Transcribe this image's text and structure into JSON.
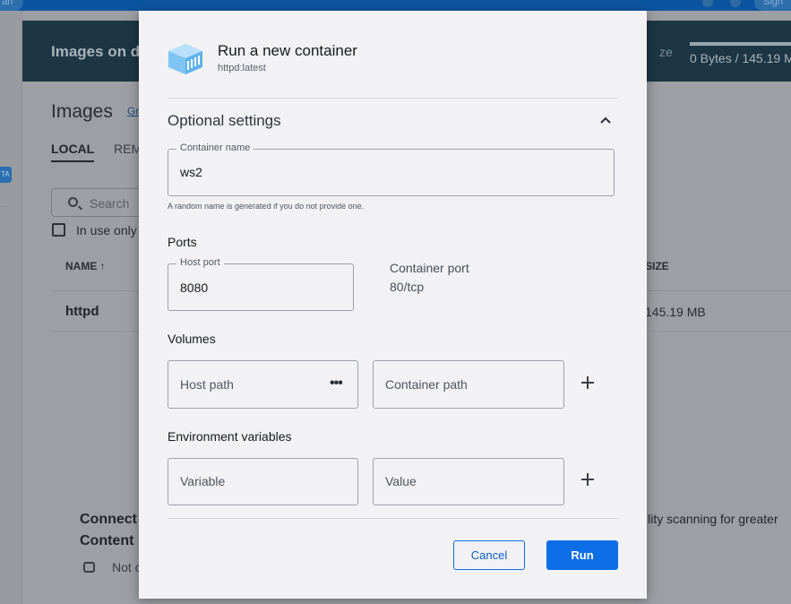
{
  "topbar": {
    "left_pill": "an",
    "right_pill": "Sign"
  },
  "sidebar": {
    "beta_badge": "TA"
  },
  "banner": {
    "title": "Images on di",
    "size_label": "ze",
    "size_value": "0 Bytes / 145.19 M",
    "usage_fraction": 1.0
  },
  "images_page": {
    "title": "Images",
    "title_link": "Gr",
    "tabs": [
      "LOCAL",
      "REM"
    ],
    "search_placeholder": "Search",
    "in_use_only_label": "In use only",
    "columns": {
      "name": "NAME",
      "size": "SIZE"
    },
    "rows": [
      {
        "name": "httpd",
        "size": "145.19 MB"
      }
    ],
    "connect_heading_line1": "Connect",
    "connect_heading_line2": "Content",
    "connect_right_text": "ility scanning for greater",
    "not_connected_text": "Not c"
  },
  "modal": {
    "title": "Run a new container",
    "subtitle": "httpd:latest",
    "optional_settings": "Optional settings",
    "container_name": {
      "legend": "Container name",
      "value": "ws2",
      "helper": "A random name is generated if you do not provide one."
    },
    "ports": {
      "heading": "Ports",
      "host_port_legend": "Host port",
      "host_port_value": "8080",
      "container_port_label": "Container port",
      "container_port_value": "80/tcp"
    },
    "volumes": {
      "heading": "Volumes",
      "host_path_placeholder": "Host path",
      "container_path_placeholder": "Container path"
    },
    "env": {
      "heading": "Environment variables",
      "variable_placeholder": "Variable",
      "value_placeholder": "Value"
    },
    "buttons": {
      "cancel": "Cancel",
      "run": "Run"
    }
  },
  "colors": {
    "primary": "#0d6fe6",
    "modal_bg": "#f2f2f5",
    "banner_bg": "#1d3644",
    "overlay": "#9c9fa3"
  }
}
